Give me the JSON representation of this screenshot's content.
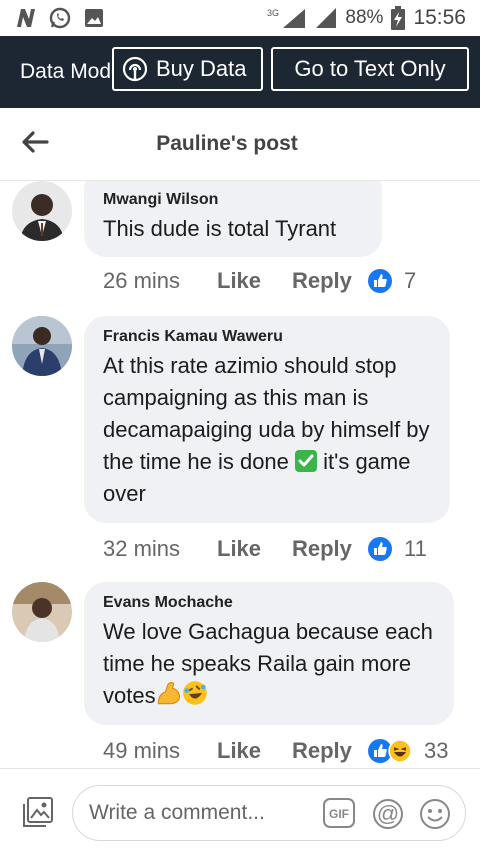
{
  "status_bar": {
    "battery": "88%",
    "time": "15:56",
    "network": "3G"
  },
  "banner": {
    "mode_text": "Data Mode",
    "buy_data_label": "Buy Data",
    "text_only_label": "Go to Text Only"
  },
  "header": {
    "title": "Pauline's post"
  },
  "comments": [
    {
      "author": "Mwangi Wilson",
      "text": "This dude is total Tyrant",
      "time": "26 mins",
      "like_label": "Like",
      "reply_label": "Reply",
      "reaction_count": "7"
    },
    {
      "author": "Francis Kamau Waweru",
      "text_part1": "At this rate azimio should stop campaigning as this man is decamapaiging uda by himself by the time he is done ",
      "text_part2": " it's game over",
      "time": "32 mins",
      "like_label": "Like",
      "reply_label": "Reply",
      "reaction_count": "11"
    },
    {
      "author": "Evans Mochache",
      "text": "We love Gachagua because each time he speaks Raila gain more votes",
      "time": "49 mins",
      "like_label": "Like",
      "reply_label": "Reply",
      "reaction_count": "33"
    }
  ],
  "composer": {
    "placeholder": "Write a comment...",
    "gif_label": "GIF"
  }
}
